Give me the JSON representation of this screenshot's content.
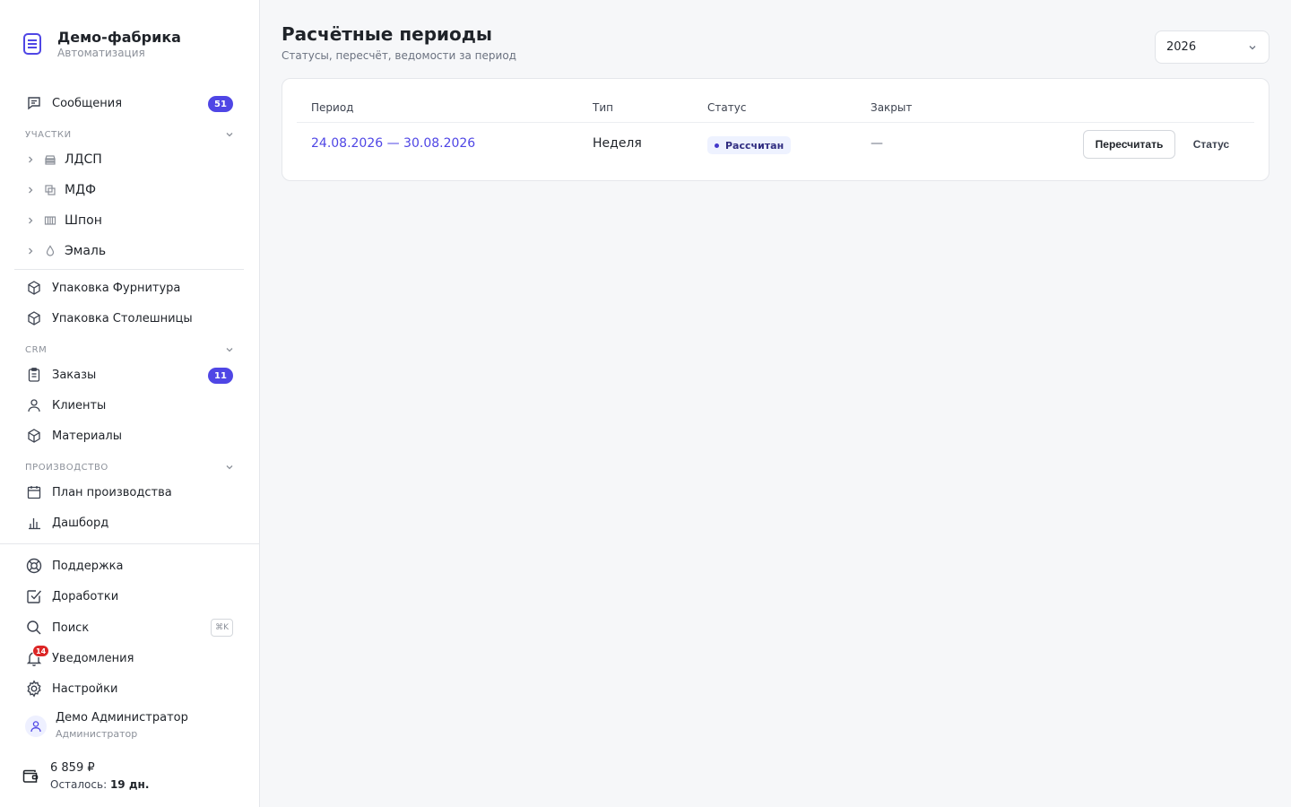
{
  "brand": {
    "name": "Демо-фабрика",
    "subtitle": "Автоматизация"
  },
  "sidebar": {
    "messages": {
      "label": "Сообщения",
      "badge": "51"
    },
    "section_participants": "Участки",
    "participants": [
      {
        "label": "ЛДСП",
        "icon": "layers-icon"
      },
      {
        "label": "МДФ",
        "icon": "copy-icon"
      },
      {
        "label": "Шпон",
        "icon": "veneer-icon"
      },
      {
        "label": "Эмаль",
        "icon": "drop-icon"
      }
    ],
    "packaging": [
      {
        "label": "Упаковка Фурнитура"
      },
      {
        "label": "Упаковка Столешницы"
      }
    ],
    "section_crm": "CRM",
    "crm": {
      "orders": {
        "label": "Заказы",
        "badge": "11"
      },
      "clients": {
        "label": "Клиенты"
      },
      "materials": {
        "label": "Материалы"
      }
    },
    "section_production": "Производство",
    "production": {
      "plan": {
        "label": "План производства"
      },
      "dashboard": {
        "label": "Дашборд"
      }
    },
    "bottom": {
      "support": "Поддержка",
      "improvements": "Доработки",
      "search": "Поиск",
      "search_shortcut": "⌘K",
      "notifications": "Уведомления",
      "notifications_badge": "14",
      "settings": "Настройки"
    },
    "user": {
      "name": "Демо Администратор",
      "role": "Администратор"
    },
    "wallet": {
      "amount": "6 859 ₽",
      "left_label": "Осталось:",
      "left_value": "19 дн."
    }
  },
  "main": {
    "title": "Расчётные периоды",
    "subtitle": "Статусы, пересчёт, ведомости за период",
    "year": "2026",
    "table": {
      "headers": {
        "period": "Период",
        "type": "Тип",
        "status": "Статус",
        "closed": "Закрыт"
      },
      "rows": [
        {
          "period": "24.08.2026 — 30.08.2026",
          "type": "Неделя",
          "status": "Рассчитан",
          "closed": "—",
          "action_recalc": "Пересчитать",
          "action_status": "Статус"
        }
      ]
    }
  },
  "colors": {
    "accent": "#4f46e5",
    "danger": "#dc2626"
  }
}
